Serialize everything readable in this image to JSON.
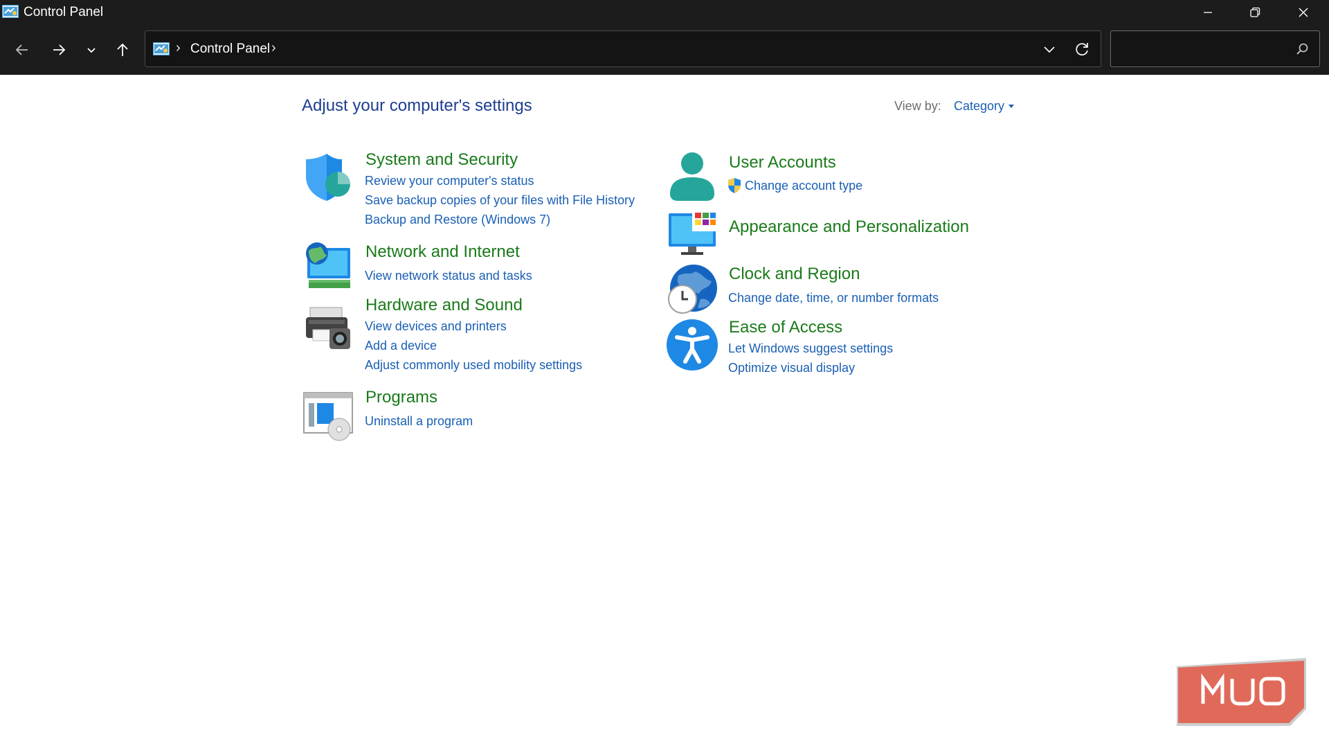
{
  "window": {
    "title": "Control Panel"
  },
  "address_bar": {
    "crumb": "Control Panel",
    "separator": "›"
  },
  "search": {
    "placeholder": "",
    "value": ""
  },
  "page": {
    "title": "Adjust your computer's settings",
    "view_by_label": "View by:",
    "view_by_value": "Category"
  },
  "categories": [
    {
      "title": "System and Security",
      "icon": "shield-icon",
      "links": [
        "Review your computer's status",
        "Save backup copies of your files with File History",
        "Backup and Restore (Windows 7)"
      ]
    },
    {
      "title": "Network and Internet",
      "icon": "network-icon",
      "links": [
        "View network status and tasks"
      ]
    },
    {
      "title": "Hardware and Sound",
      "icon": "printer-icon",
      "links": [
        "View devices and printers",
        "Add a device",
        "Adjust commonly used mobility settings"
      ]
    },
    {
      "title": "Programs",
      "icon": "programs-icon",
      "links": [
        "Uninstall a program"
      ]
    },
    {
      "title": "User Accounts",
      "icon": "user-icon",
      "links": [
        "Change account type"
      ]
    },
    {
      "title": "Appearance and Personalization",
      "icon": "monitor-icon",
      "links": []
    },
    {
      "title": "Clock and Region",
      "icon": "clock-globe-icon",
      "links": [
        "Change date, time, or number formats"
      ]
    },
    {
      "title": "Ease of Access",
      "icon": "accessibility-icon",
      "links": [
        "Let Windows suggest settings",
        "Optimize visual display"
      ]
    }
  ],
  "watermark": {
    "text": "MUO"
  },
  "colors": {
    "category_title": "#1a7a1a",
    "link": "#1a5fb4",
    "page_title": "#1e3d8f",
    "chrome_bg": "#1c1c1c"
  }
}
